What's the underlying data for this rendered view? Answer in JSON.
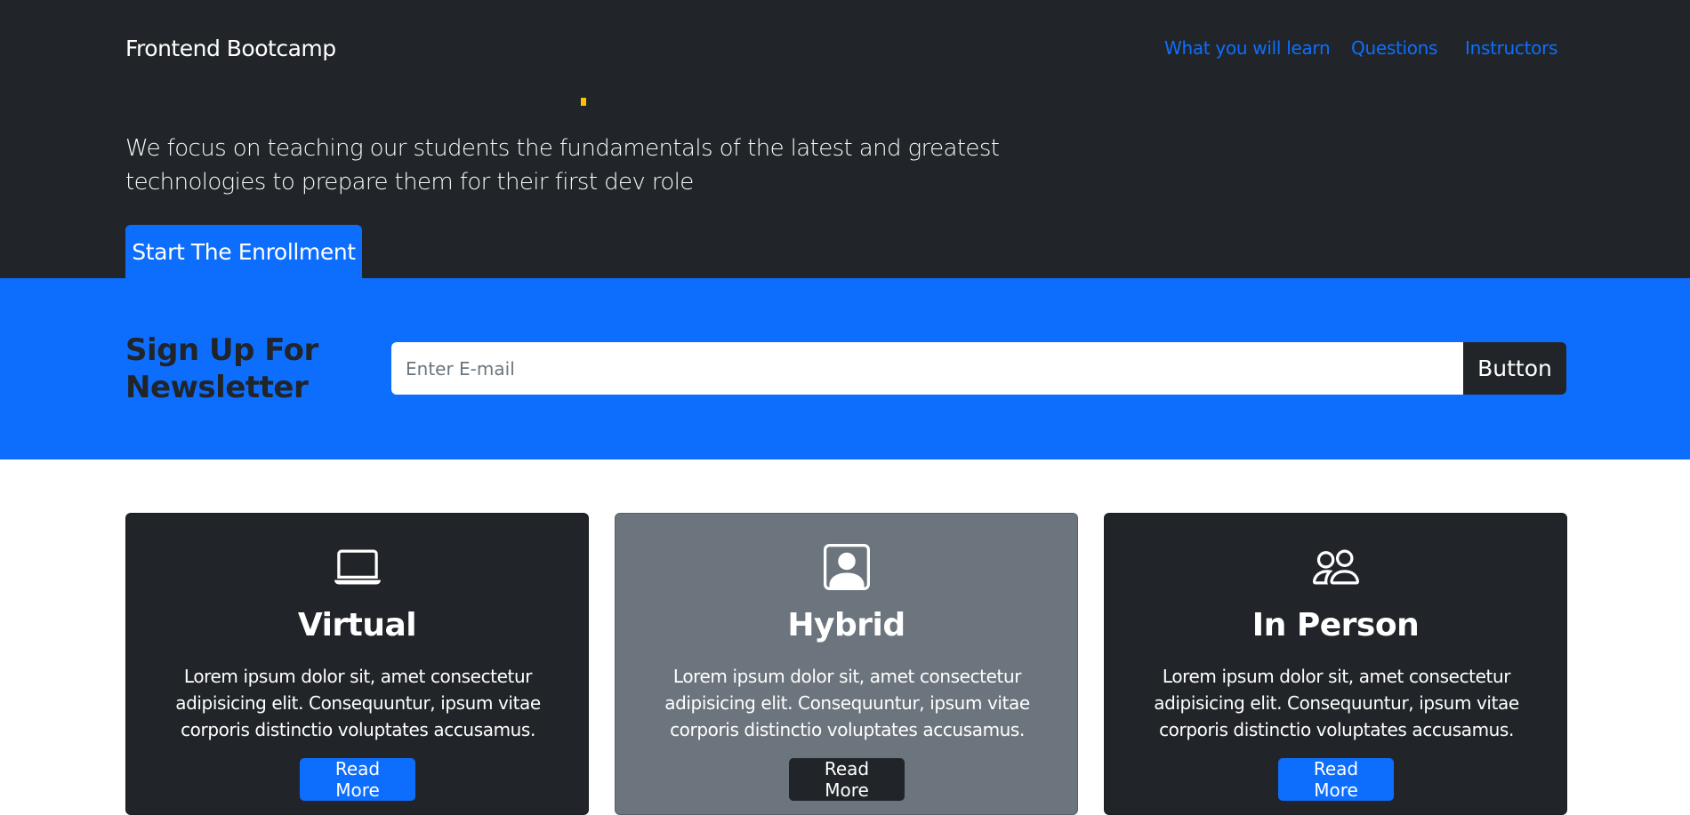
{
  "navbar": {
    "brand": "Frontend Bootcamp",
    "links": [
      {
        "label": "What you will learn"
      },
      {
        "label": "Questions"
      },
      {
        "label": "Instructors"
      }
    ]
  },
  "hero": {
    "lead": "We focus on teaching our students the fundamentals of the latest and greatest technologies to prepare them for their first dev role",
    "cta_label": "Start The Enrollment"
  },
  "newsletter": {
    "title": "Sign Up For Newsletter",
    "input_placeholder": "Enter E-mail",
    "button_label": "Button"
  },
  "cards": [
    {
      "icon": "laptop-icon",
      "title": "Virtual",
      "text": "Lorem ipsum dolor sit, amet consectetur adipisicing elit. Consequuntur, ipsum vitae corporis distinctio voluptates accusamus.",
      "button_label": "Read More"
    },
    {
      "icon": "person-square-icon",
      "title": "Hybrid",
      "text": "Lorem ipsum dolor sit, amet consectetur adipisicing elit. Consequuntur, ipsum vitae corporis distinctio voluptates accusamus.",
      "button_label": "Read More"
    },
    {
      "icon": "people-icon",
      "title": "In Person",
      "text": "Lorem ipsum dolor sit, amet consectetur adipisicing elit. Consequuntur, ipsum vitae corporis distinctio voluptates accusamus.",
      "button_label": "Read More"
    }
  ],
  "colors": {
    "dark": "#212529",
    "primary": "#0d6efd",
    "secondary": "#6c757d",
    "accent_mark": "#ffc107"
  }
}
